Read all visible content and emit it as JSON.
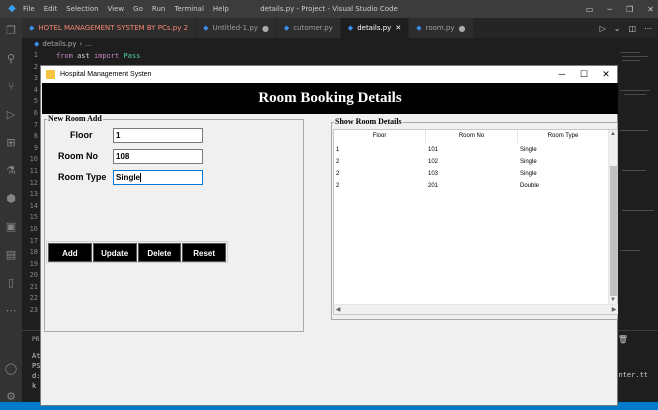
{
  "vscode": {
    "menu": [
      "File",
      "Edit",
      "Selection",
      "View",
      "Go",
      "Run",
      "Terminal",
      "Help"
    ],
    "window_title": "details.py - Project - Visual Studio Code",
    "tabs": [
      {
        "label": "HOTEL MANAGEMENT SYSTEM BY PCs.py 2"
      },
      {
        "label": "Untitled-1.py"
      },
      {
        "label": "cutomer.py"
      },
      {
        "label": "details.py"
      },
      {
        "label": "room.py"
      }
    ],
    "breadcrumb": "details.py",
    "line_numbers": [
      "1",
      "2",
      "3",
      "4",
      "5",
      "6",
      "7",
      "8",
      "9",
      "10",
      "11",
      "12",
      "13",
      "14",
      "15",
      "16",
      "17",
      "18",
      "19",
      "20",
      "21",
      "22",
      "23"
    ],
    "code_line_1": {
      "kw1": "from",
      "mod": "ast",
      "kw2": "import",
      "name": "Pass"
    },
    "terminal_lines": [
      "Ati",
      "PS",
      "d:",
      "k"
    ],
    "terminal_right": "inter.tt",
    "panel_label": "PR"
  },
  "tk_window": {
    "title": "Hospital Management Systen",
    "header": "Room Booking Details",
    "new_room_frame": {
      "label": "New Room Add",
      "fields": [
        {
          "label": "Floor",
          "value": "1"
        },
        {
          "label": "Room No",
          "value": "108"
        },
        {
          "label": "Room Type",
          "value": "Single"
        }
      ],
      "buttons": [
        "Add",
        "Update",
        "Delete",
        "Reset"
      ]
    },
    "show_frame": {
      "label": "Show Room Details",
      "columns": [
        "Floor",
        "Room No",
        "Room Type"
      ],
      "rows": [
        [
          "1",
          "101",
          "Single"
        ],
        [
          "2",
          "102",
          "Single"
        ],
        [
          "2",
          "103",
          "Single"
        ],
        [
          "2",
          "201",
          "Double"
        ]
      ]
    }
  }
}
